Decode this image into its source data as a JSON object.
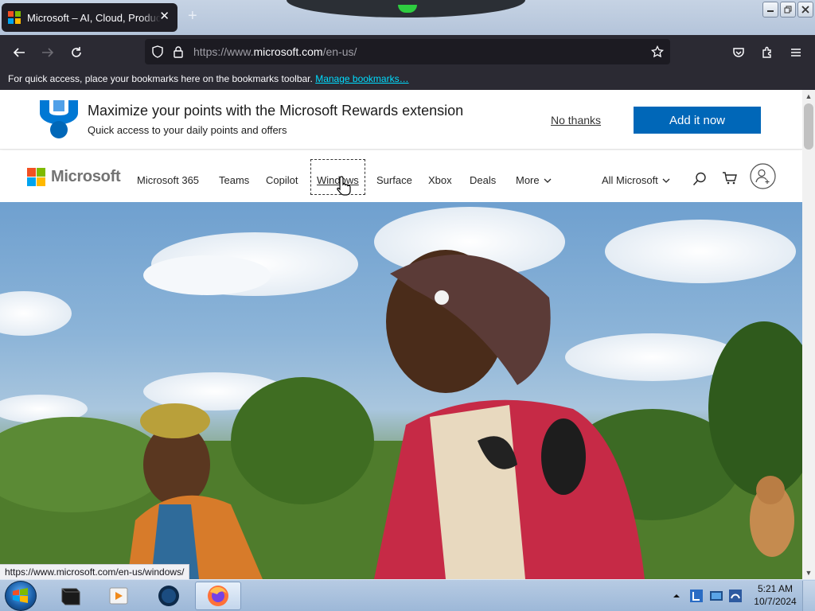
{
  "browser": {
    "tab_title": "Microsoft – AI, Cloud, Productivity, Computing",
    "tab_close": "✕",
    "new_tab": "+",
    "url_prefix": "https://www.",
    "url_host": "microsoft.com",
    "url_path": "/en-us/",
    "bookmarks_message": "For quick access, place your bookmarks here on the bookmarks toolbar.",
    "manage_bookmarks": "Manage bookmarks…",
    "status_link": "https://www.microsoft.com/en-us/windows/"
  },
  "banner": {
    "title": "Maximize your points with the Microsoft Rewards extension",
    "subtitle": "Quick access to your daily points and offers",
    "no_thanks": "No thanks",
    "add_now": "Add it now"
  },
  "header": {
    "logo_text": "Microsoft",
    "nav": [
      "Microsoft 365",
      "Teams",
      "Copilot",
      "Windows",
      "Surface",
      "Xbox",
      "Deals",
      "More"
    ],
    "all_microsoft": "All Microsoft"
  },
  "taskbar": {
    "time": "5:21 AM",
    "date": "10/7/2024"
  },
  "colors": {
    "ms_red": "#f25022",
    "ms_green": "#7fba00",
    "ms_blue": "#00a4ef",
    "ms_yellow": "#ffb900",
    "accent_blue": "#0067b8",
    "browser_dark": "#2b2a33"
  },
  "icons": [
    "back-icon",
    "forward-icon",
    "reload-icon",
    "shield-icon",
    "lock-icon",
    "star-icon",
    "pocket-icon",
    "extensions-icon",
    "menu-icon",
    "search-icon",
    "cart-icon",
    "account-icon",
    "windows-start-icon"
  ]
}
